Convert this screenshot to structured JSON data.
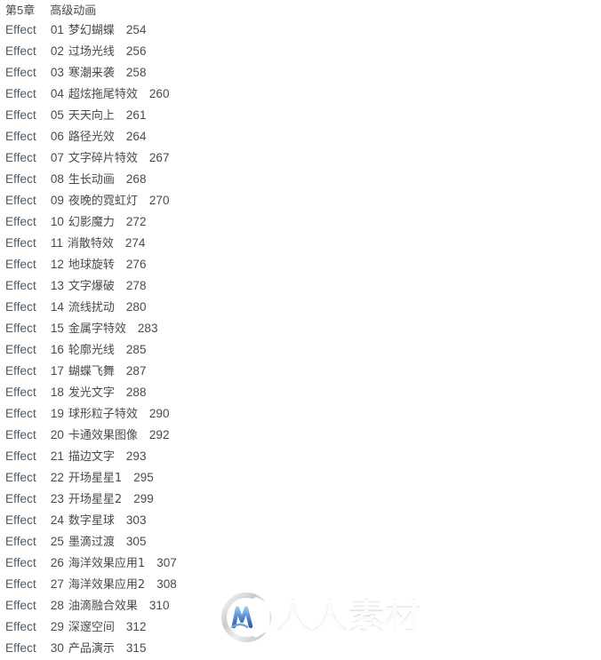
{
  "page": {
    "background_color": "#ffffff",
    "text_color": "#4a4a4a",
    "label_color": "#4c5a66"
  },
  "chapter": {
    "number": "第5章",
    "title": "高级动画"
  },
  "entries": [
    {
      "label": "Effect",
      "num": "01",
      "title": "梦幻蝴蝶",
      "page": "254"
    },
    {
      "label": "Effect",
      "num": "02",
      "title": "过场光线",
      "page": "256"
    },
    {
      "label": "Effect",
      "num": "03",
      "title": "寒潮来袭",
      "page": "258"
    },
    {
      "label": "Effect",
      "num": "04",
      "title": "超炫拖尾特效",
      "page": "260"
    },
    {
      "label": "Effect",
      "num": "05",
      "title": "天天向上",
      "page": "261"
    },
    {
      "label": "Effect",
      "num": "06",
      "title": "路径光效",
      "page": "264"
    },
    {
      "label": "Effect",
      "num": "07",
      "title": "文字碎片特效",
      "page": "267"
    },
    {
      "label": "Effect",
      "num": "08",
      "title": "生长动画",
      "page": "268"
    },
    {
      "label": "Effect",
      "num": "09",
      "title": "夜晚的霓虹灯",
      "page": "270"
    },
    {
      "label": "Effect",
      "num": "10",
      "title": "幻影魔力",
      "page": "272"
    },
    {
      "label": "Effect",
      "num": "11",
      "title": "消散特效",
      "page": "274"
    },
    {
      "label": "Effect",
      "num": "12",
      "title": "地球旋转",
      "page": "276"
    },
    {
      "label": "Effect",
      "num": "13",
      "title": "文字爆破",
      "page": "278"
    },
    {
      "label": "Effect",
      "num": "14",
      "title": "流线扰动",
      "page": "280"
    },
    {
      "label": "Effect",
      "num": "15",
      "title": "金属字特效",
      "page": "283"
    },
    {
      "label": "Effect",
      "num": "16",
      "title": "轮廓光线",
      "page": "285"
    },
    {
      "label": "Effect",
      "num": "17",
      "title": "蝴蝶飞舞",
      "page": "287"
    },
    {
      "label": "Effect",
      "num": "18",
      "title": "发光文字",
      "page": "288"
    },
    {
      "label": "Effect",
      "num": "19",
      "title": "球形粒子特效",
      "page": "290"
    },
    {
      "label": "Effect",
      "num": "20",
      "title": "卡通效果图像",
      "page": "292"
    },
    {
      "label": "Effect",
      "num": "21",
      "title": "描边文字",
      "page": "293"
    },
    {
      "label": "Effect",
      "num": "22",
      "title": "开场星星1",
      "page": "295"
    },
    {
      "label": "Effect",
      "num": "23",
      "title": "开场星星2",
      "page": "299"
    },
    {
      "label": "Effect",
      "num": "24",
      "title": "数字星球",
      "page": "303"
    },
    {
      "label": "Effect",
      "num": "25",
      "title": "墨滴过渡",
      "page": "305"
    },
    {
      "label": "Effect",
      "num": "26",
      "title": "海洋效果应用1",
      "page": "307"
    },
    {
      "label": "Effect",
      "num": "27",
      "title": "海洋效果应用2",
      "page": "308"
    },
    {
      "label": "Effect",
      "num": "28",
      "title": "油滴融合效果",
      "page": "310"
    },
    {
      "label": "Effect",
      "num": "29",
      "title": "深邃空间",
      "page": "312"
    },
    {
      "label": "Effect",
      "num": "30",
      "title": "产品演示",
      "page": "315"
    }
  ],
  "watermark": {
    "text": "人人素材",
    "logo_icon": "circle-m-logo-icon",
    "logo_ring_color": "#cfd3d8",
    "logo_glyph_color": "#5b8fd4"
  }
}
